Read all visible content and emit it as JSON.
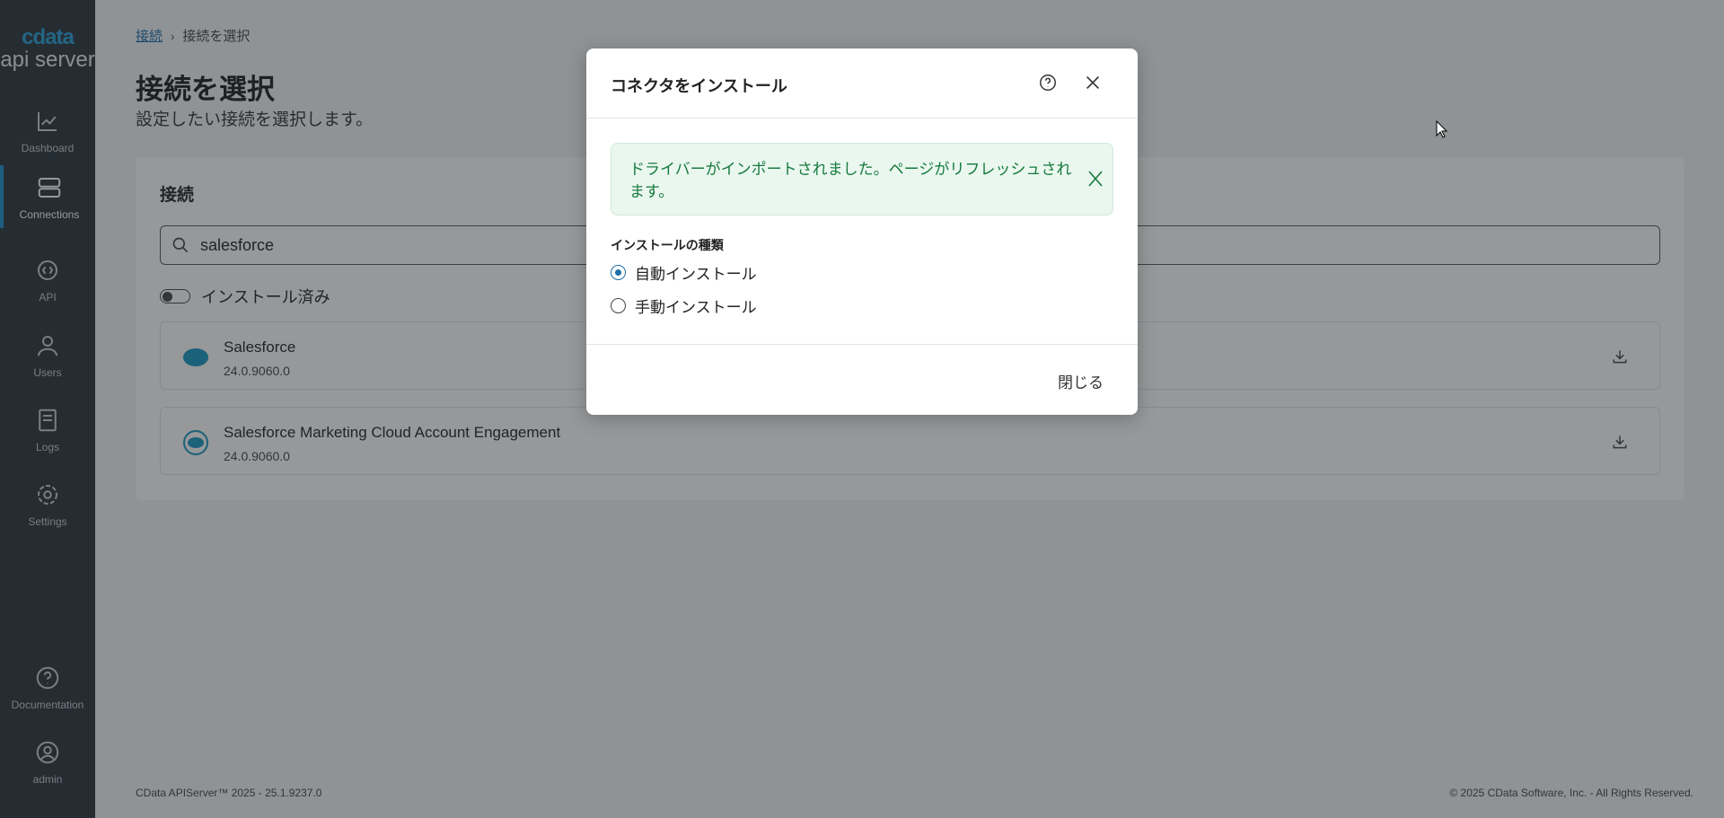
{
  "sidebar": {
    "logo_top": "cdata",
    "logo_bottom": "api server",
    "items": [
      {
        "label": "Dashboard",
        "icon": "chart-line-icon"
      },
      {
        "label": "Connections",
        "icon": "server-icon",
        "active": true
      },
      {
        "label": "API",
        "icon": "api-gear-icon"
      },
      {
        "label": "Users",
        "icon": "user-icon"
      },
      {
        "label": "Logs",
        "icon": "book-icon"
      },
      {
        "label": "Settings",
        "icon": "gear-icon"
      },
      {
        "label": "Documentation",
        "icon": "help-circle-icon"
      },
      {
        "label": "admin",
        "icon": "account-circle-icon"
      }
    ]
  },
  "breadcrumb": {
    "link": "接続",
    "separator": "›",
    "current": "接続を選択"
  },
  "page": {
    "title": "接続を選択",
    "subtitle": "設定したい接続を選択します。"
  },
  "card": {
    "heading": "接続",
    "search_value": "salesforce",
    "toggle_label": "インストール済み",
    "items": [
      {
        "name": "Salesforce",
        "version": "24.0.9060.0"
      },
      {
        "name": "Salesforce Marketing Cloud Account Engagement",
        "version": "24.0.9060.0"
      }
    ]
  },
  "footer": {
    "left": "CData APIServer™ 2025 - 25.1.9237.0",
    "right": "© 2025 CData Software, Inc. - All Rights Reserved."
  },
  "dialog": {
    "title": "コネクタをインストール",
    "alert": "ドライバーがインポートされました。ページがリフレッシュされます。",
    "install_type_label": "インストールの種類",
    "options": [
      {
        "label": "自動インストール",
        "selected": true
      },
      {
        "label": "手動インストール",
        "selected": false
      }
    ],
    "close_label": "閉じる"
  },
  "colors": {
    "accent": "#1c6fa8",
    "success": "#157a3c",
    "sidebar": "#2a363d"
  }
}
